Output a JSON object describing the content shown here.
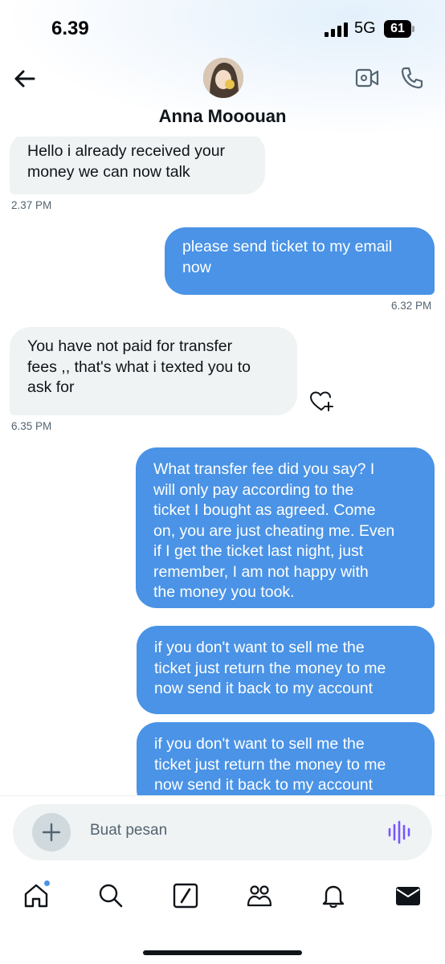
{
  "status_bar": {
    "time": "6.39",
    "network": "5G",
    "battery": "61"
  },
  "header": {
    "contact_name": "Anna Mooouan"
  },
  "messages": [
    {
      "direction": "in",
      "lines": [
        "Hello i already received your",
        "money we can now talk"
      ],
      "time": "2.37 PM"
    },
    {
      "direction": "out",
      "lines": [
        "please send ticket to my email",
        "now"
      ],
      "time": "6.32 PM"
    },
    {
      "direction": "in",
      "lines": [
        "You have not paid for transfer",
        "fees ,, that's what i texted you to",
        "ask for"
      ],
      "time": "6.35 PM"
    },
    {
      "direction": "out",
      "lines": [
        "What transfer fee did you say? I",
        "will only pay according to the",
        "ticket I bought as agreed. Come",
        "on, you are just cheating me. Even",
        "if I get the ticket last night, just",
        "remember, I am not happy with",
        "the money you took."
      ]
    },
    {
      "direction": "out",
      "lines": [
        "if you don't want to sell me the",
        "ticket just return the money to me",
        "now send it back to my account"
      ]
    },
    {
      "direction": "out",
      "lines": [
        "if you don't want to sell me the",
        "ticket just return the money to me",
        "now send it back to my account"
      ]
    }
  ],
  "composer": {
    "placeholder": "Buat pesan"
  },
  "icons": {
    "back": "arrow-left-icon",
    "video": "video-camera-icon",
    "call": "phone-icon",
    "react": "heart-plus-icon",
    "add": "plus-icon",
    "voice": "voice-wave-icon",
    "tabs": [
      "home-icon",
      "search-icon",
      "grok-icon",
      "communities-icon",
      "bell-icon",
      "mail-icon"
    ]
  },
  "colors": {
    "outgoing_bubble": "#4a93e6",
    "incoming_bubble": "#eff3f4",
    "accent": "#4a93e6"
  }
}
